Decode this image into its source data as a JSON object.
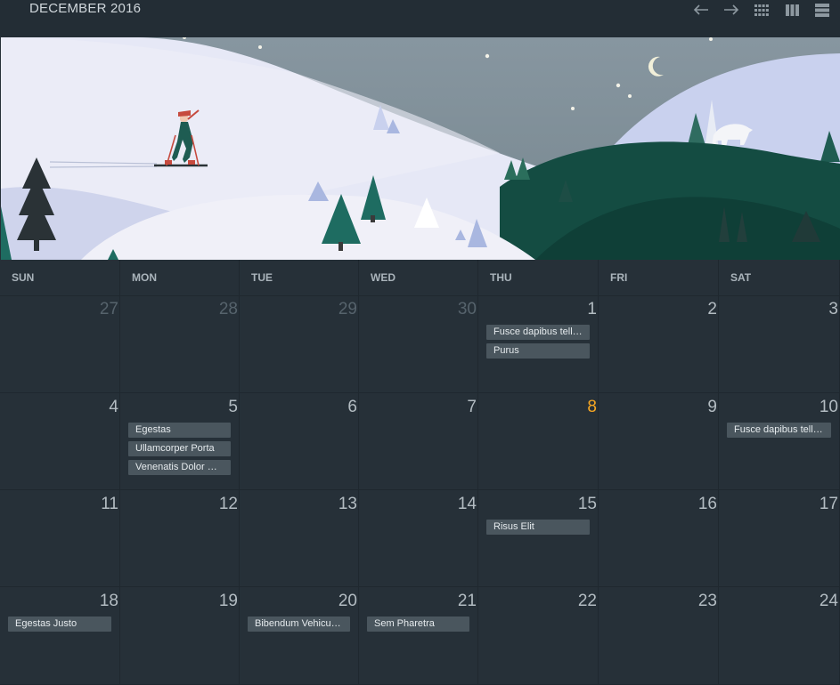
{
  "header": {
    "month_title": "DECEMBER 2016",
    "buttons": [
      {
        "name": "prev-month-button",
        "icon": "arrow-left-icon"
      },
      {
        "name": "next-month-button",
        "icon": "arrow-right-icon"
      },
      {
        "name": "month-view-button",
        "icon": "grid-icon"
      },
      {
        "name": "week-view-button",
        "icon": "columns-icon"
      },
      {
        "name": "list-view-button",
        "icon": "rows-icon"
      }
    ]
  },
  "colors": {
    "background": "#263038",
    "topbar": "#232d35",
    "event": "#4a565e",
    "today": "#f5a623"
  },
  "calendar": {
    "weekdays": [
      "SUN",
      "MON",
      "TUE",
      "WED",
      "THU",
      "FRI",
      "SAT"
    ],
    "weeks": [
      [
        {
          "day": "27",
          "other": true,
          "events": []
        },
        {
          "day": "28",
          "other": true,
          "events": []
        },
        {
          "day": "29",
          "other": true,
          "events": []
        },
        {
          "day": "30",
          "other": true,
          "events": []
        },
        {
          "day": "1",
          "events": [
            "Fusce dapibus tell…",
            "Purus"
          ]
        },
        {
          "day": "2",
          "events": []
        },
        {
          "day": "3",
          "events": []
        }
      ],
      [
        {
          "day": "4",
          "events": []
        },
        {
          "day": "5",
          "events": [
            "Egestas",
            "Ullamcorper Porta",
            "Venenatis Dolor P…"
          ]
        },
        {
          "day": "6",
          "events": []
        },
        {
          "day": "7",
          "events": []
        },
        {
          "day": "8",
          "today": true,
          "events": []
        },
        {
          "day": "9",
          "events": []
        },
        {
          "day": "10",
          "events": [
            "Fusce dapibus tell…"
          ]
        }
      ],
      [
        {
          "day": "11",
          "events": []
        },
        {
          "day": "12",
          "events": []
        },
        {
          "day": "13",
          "events": []
        },
        {
          "day": "14",
          "events": []
        },
        {
          "day": "15",
          "events": [
            "Risus Elit"
          ]
        },
        {
          "day": "16",
          "events": []
        },
        {
          "day": "17",
          "events": []
        }
      ],
      [
        {
          "day": "18",
          "events": [
            "Egestas Justo"
          ]
        },
        {
          "day": "19",
          "events": []
        },
        {
          "day": "20",
          "events": [
            "Bibendum Vehicul…"
          ]
        },
        {
          "day": "21",
          "events": [
            "Sem Pharetra"
          ]
        },
        {
          "day": "22",
          "events": []
        },
        {
          "day": "23",
          "events": []
        },
        {
          "day": "24",
          "events": []
        }
      ]
    ]
  }
}
